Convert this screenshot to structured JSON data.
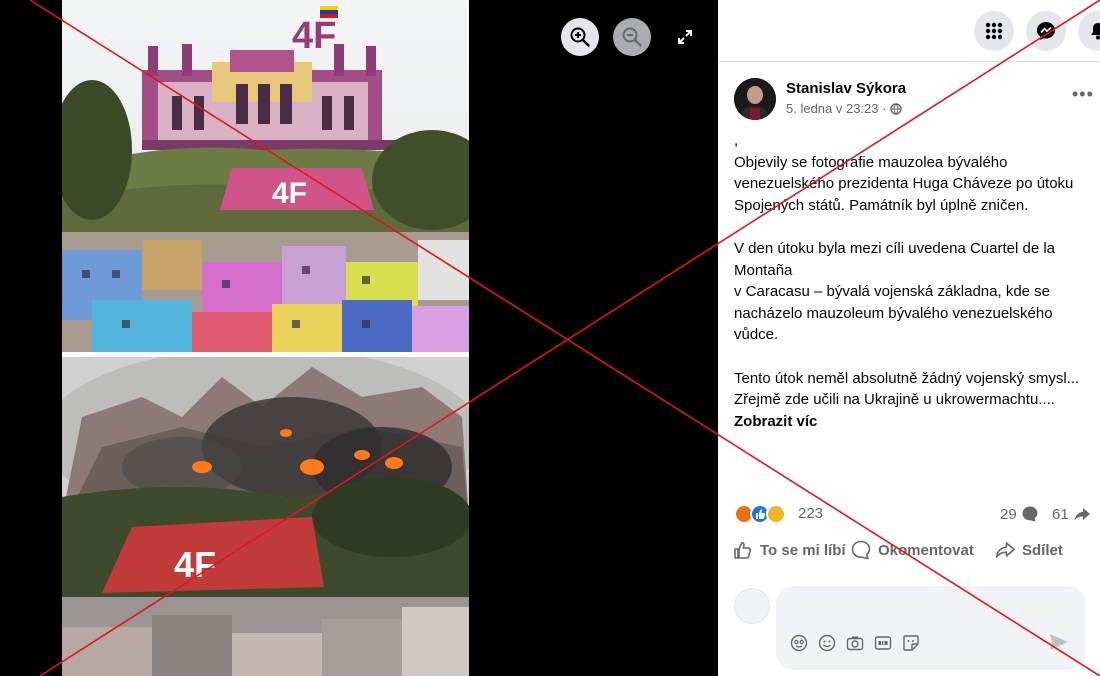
{
  "viewer": {
    "zoom_in_icon": "zoom-in-icon",
    "zoom_out_icon": "zoom-out-icon",
    "fullscreen_icon": "expand-icon",
    "photo_top_label": "4F",
    "photo_bottom_label": "4F"
  },
  "topbar": {
    "icons": [
      "menu-grid-icon",
      "messenger-icon",
      "notifications-icon"
    ]
  },
  "post": {
    "author": "Stanislav Sýkora",
    "date": "5. ledna v 23:23 ·",
    "privacy_icon": "globe-icon",
    "more_label": "•••",
    "body_lines": [
      ",",
      "Objevily se fotografie mauzolea bývalého venezuelského prezidenta Huga Cháveze po útoku Spojených států. Památník byl úplně zničen.",
      "",
      "V den útoku byla mezi cíli uvedena Cuartel de la Montaña",
      "v Caracasu – bývalá vojenská základna, kde se nacházelo mauzoleum bývalého venezuelského vůdce.",
      "",
      "Tento útok neměl absolutně žádný vojenský smysl...",
      "Zřejmě zde učili na Ukrajině u ukrowermachtu...."
    ],
    "see_more": "Zobrazit víc",
    "reactions": {
      "count": "223",
      "types": [
        "angry",
        "like",
        "sad"
      ],
      "comments": "29",
      "shares": "61"
    },
    "actions": {
      "like": "To se mi líbí",
      "comment": "Okomentovat",
      "share": "Sdílet"
    },
    "composer": {
      "placeholder": "",
      "icons": [
        "avatar-sticker-icon",
        "emoji-icon",
        "camera-icon",
        "gif-icon",
        "sticker-icon"
      ]
    }
  },
  "colors": {
    "overlay_red": "#e3141b",
    "text_secondary": "#65676b",
    "button_gray": "#e4e6eb",
    "composer_bg": "#f0f2f5"
  }
}
